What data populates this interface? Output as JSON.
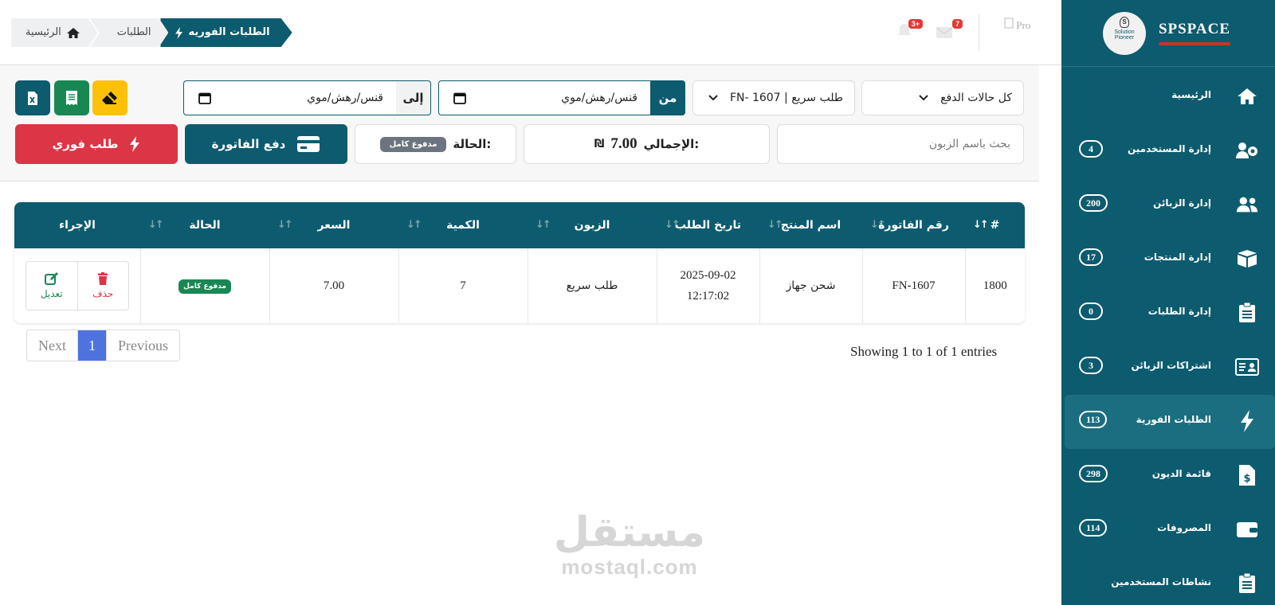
{
  "sidebar": {
    "brand": "SPSPACE",
    "logo_text": [
      "S",
      "Solution",
      "Pioneer"
    ],
    "items": [
      {
        "label": "الرئيسية",
        "badge": "",
        "icon": "home-icon"
      },
      {
        "label": "إدارة المستخدمين",
        "badge": "4",
        "icon": "users-cog-icon"
      },
      {
        "label": "إدارة الزبائن",
        "badge": "200",
        "icon": "customers-icon"
      },
      {
        "label": "إدارة المنتجات",
        "badge": "17",
        "icon": "box-icon"
      },
      {
        "label": "إدارة الطلبات",
        "badge": "0",
        "icon": "clipboard-icon"
      },
      {
        "label": "اشتراكات الزبائن",
        "badge": "3",
        "icon": "id-card-icon"
      },
      {
        "label": "الطلبات الفورية",
        "badge": "113",
        "icon": "bolt-icon",
        "active": true
      },
      {
        "label": "قائمة الديون",
        "badge": "298",
        "icon": "invoice-dollar-icon"
      },
      {
        "label": "المصروفات",
        "badge": "114",
        "icon": "wallet-icon"
      },
      {
        "label": "نشاطات المستخدمين",
        "badge": "",
        "icon": "clipboard-list-icon"
      }
    ]
  },
  "header": {
    "breadcrumb": {
      "home": "الرئيسية",
      "orders": "الطلبات",
      "current": "الطلبات الفوريه"
    },
    "notifications_badge": "3+",
    "messages_badge": "7",
    "profile_alt": "Pro"
  },
  "filters": {
    "payment_status": "كل حالات الدفع",
    "invoice_select": "FN- 1607 | طلب سريع",
    "from_label": "من",
    "from_placeholder": "قنس/رهش/موي",
    "to_label": "إلى",
    "to_placeholder": "قنس/رهش/موي",
    "search_placeholder": "بحث باسم الزبون",
    "total_label": "الإجمالي:",
    "total_value": "7.00",
    "currency": "₪",
    "status_label": "الحالة:",
    "status_value": "مدفوع كامل",
    "pay_button": "دفع الفاتورة",
    "quick_order_button": "طلب فوري"
  },
  "table": {
    "headers": [
      "#",
      "رقم الفاتورة",
      "اسم المنتج",
      "تاريخ الطلب",
      "الزبون",
      "الكمية",
      "السعر",
      "الحالة",
      "الإجراء"
    ],
    "rows": [
      {
        "id": "1800",
        "invoice": "FN-1607",
        "product": "شحن جهاز",
        "date": "2025-09-02",
        "time": "12:17:02",
        "customer": "طلب سريع",
        "qty": "7",
        "price": "7.00",
        "status": "مدفوع كامل",
        "delete_label": "حذف",
        "edit_label": "تعديل"
      }
    ]
  },
  "pagination": {
    "previous": "Previous",
    "current": "1",
    "next": "Next",
    "info": "Showing 1 to 1 of 1 entries"
  },
  "watermark": {
    "arabic": "مستقل",
    "latin": "mostaql.com"
  },
  "colors": {
    "primary": "#0d5b6e",
    "danger": "#dc3545",
    "success": "#198754",
    "warning": "#ffc107",
    "pager_active": "#4e73df"
  }
}
